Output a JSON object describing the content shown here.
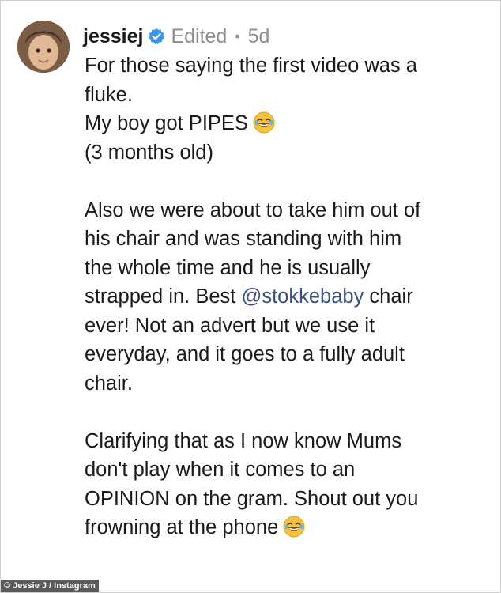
{
  "post": {
    "username": "jessiej",
    "edited_label": "Edited",
    "separator": "•",
    "time_ago": "5d",
    "caption_lines": [
      "For those saying the first video was a",
      "fluke.",
      "My boy got PIPES",
      "(3 months old)",
      "Also we were about to take him out of",
      "his chair and was standing with him",
      "the whole time and he is usually",
      "strapped in. Best ",
      "@stokkebaby",
      " chair",
      "ever! Not an advert but we use it",
      "everyday, and it goes to a fully adult",
      "chair.",
      "Clarifying that as I now know Mums",
      "don't play when it comes to an",
      "OPINION on the gram. Shout out you",
      "frowning at the phone"
    ],
    "icons": {
      "verified": "verified-badge-icon",
      "emoji": "laughing-crying-emoji-icon"
    }
  },
  "credit": "© Jessie J / Instagram",
  "colors": {
    "verified_blue": "#3897f0",
    "mention": "#385185",
    "muted": "#8e8e8e"
  }
}
